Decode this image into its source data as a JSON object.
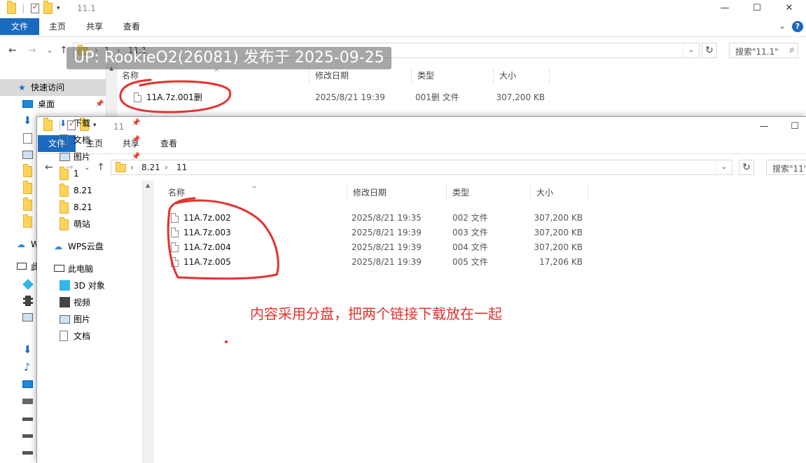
{
  "watermark": "UP: RookieO2(26081) 发布于 2025-09-25",
  "annotation": "内容采用分盘，把两个链接下载放在一起",
  "back_window": {
    "title": "11.1",
    "tabs": [
      "文件",
      "主页",
      "共享",
      "查看"
    ],
    "address": [
      "1",
      "11.1"
    ],
    "search_placeholder": "搜索\"11.1\"",
    "columns": [
      "名称",
      "修改日期",
      "类型",
      "大小"
    ],
    "nav": {
      "quick_access": "快速访问",
      "desktop": "桌面",
      "w_label": "W",
      "pc_label": "此"
    },
    "files": [
      {
        "name": "11A.7z.001删",
        "date": "2025/8/21 19:39",
        "type": "001删 文件",
        "size": "307,200 KB"
      }
    ]
  },
  "front_window": {
    "title": "11",
    "tabs": [
      "文件",
      "主页",
      "共享",
      "查看"
    ],
    "address": [
      "8.21",
      "11"
    ],
    "search_placeholder": "搜索\"11\"",
    "columns": [
      "名称",
      "修改日期",
      "类型",
      "大小"
    ],
    "nav": [
      {
        "label": "快速访问",
        "icon": "star-icon"
      },
      {
        "label": "桌面",
        "icon": "desktop-icon",
        "pinned": true
      },
      {
        "label": "下载",
        "icon": "download-icon",
        "pinned": true
      },
      {
        "label": "文档",
        "icon": "documents-icon",
        "pinned": true
      },
      {
        "label": "图片",
        "icon": "pictures-icon",
        "pinned": true
      },
      {
        "label": "1",
        "icon": "folder-icon"
      },
      {
        "label": "8.21",
        "icon": "folder-icon"
      },
      {
        "label": "8.21",
        "icon": "folder-icon"
      },
      {
        "label": "萌站",
        "icon": "folder-icon"
      },
      {
        "label": "WPS云盘",
        "icon": "cloud-icon"
      },
      {
        "label": "此电脑",
        "icon": "computer-icon"
      },
      {
        "label": "3D 对象",
        "icon": "3d-objects-icon"
      },
      {
        "label": "视频",
        "icon": "videos-icon"
      },
      {
        "label": "图片",
        "icon": "pictures-icon"
      },
      {
        "label": "文档",
        "icon": "documents-icon"
      }
    ],
    "files": [
      {
        "name": "11A.7z.002",
        "date": "2025/8/21 19:35",
        "type": "002 文件",
        "size": "307,200 KB"
      },
      {
        "name": "11A.7z.003",
        "date": "2025/8/21 19:39",
        "type": "003 文件",
        "size": "307,200 KB"
      },
      {
        "name": "11A.7z.004",
        "date": "2025/8/21 19:39",
        "type": "004 文件",
        "size": "307,200 KB"
      },
      {
        "name": "11A.7z.005",
        "date": "2025/8/21 19:39",
        "type": "005 文件",
        "size": "17,206 KB"
      }
    ]
  },
  "colors": {
    "file_tab": "#1a6bc0",
    "annotation": "#e5312f",
    "folder": "#ffd45a"
  }
}
